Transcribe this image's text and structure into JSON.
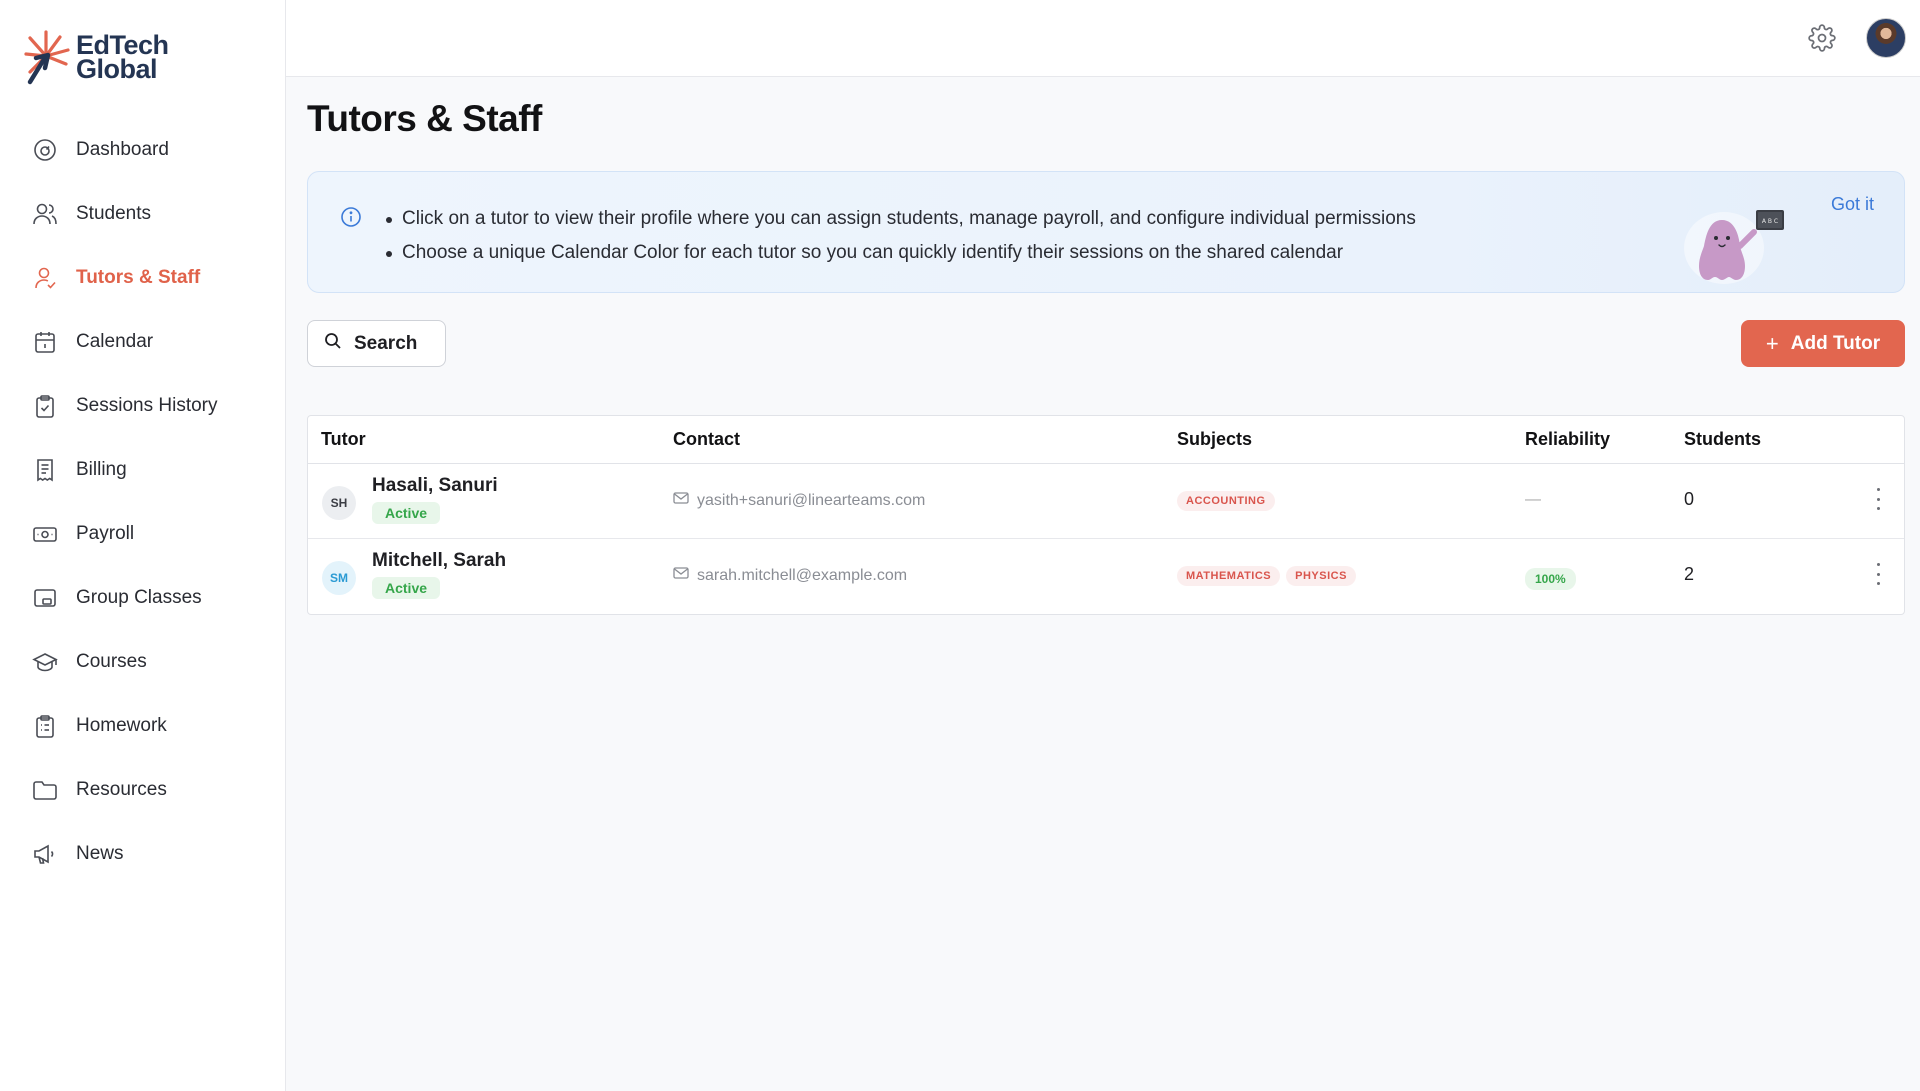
{
  "app": {
    "logo_line1": "EdTech",
    "logo_line2": "Global",
    "brand_color": "#e2664f",
    "brand_dark": "#243553"
  },
  "sidebar": {
    "items": [
      {
        "label": "Dashboard",
        "icon": "dashboard-gauge-icon",
        "active": false
      },
      {
        "label": "Students",
        "icon": "users-icon",
        "active": false
      },
      {
        "label": "Tutors & Staff",
        "icon": "user-check-icon",
        "active": true
      },
      {
        "label": "Calendar",
        "icon": "calendar-icon",
        "active": false
      },
      {
        "label": "Sessions History",
        "icon": "clipboard-check-icon",
        "active": false
      },
      {
        "label": "Billing",
        "icon": "receipt-icon",
        "active": false
      },
      {
        "label": "Payroll",
        "icon": "banknote-icon",
        "active": false
      },
      {
        "label": "Group Classes",
        "icon": "presentation-icon",
        "active": false
      },
      {
        "label": "Courses",
        "icon": "graduation-cap-icon",
        "active": false
      },
      {
        "label": "Homework",
        "icon": "clipboard-list-icon",
        "active": false
      },
      {
        "label": "Resources",
        "icon": "folder-icon",
        "active": false
      },
      {
        "label": "News",
        "icon": "megaphone-icon",
        "active": false
      }
    ]
  },
  "topbar": {
    "settings_icon": "gear-icon",
    "avatar_icon": "user-avatar"
  },
  "main": {
    "title": "Tutors & Staff",
    "info": {
      "bullets": [
        "Click on a tutor to view their profile where you can assign students, manage payroll, and configure individual permissions",
        "Choose a unique Calendar Color for each tutor so you can quickly identify their sessions on the shared calendar"
      ],
      "dismiss_label": "Got it",
      "chalkboard_text": "A B C"
    },
    "search_label": "Search",
    "add_label": "Add Tutor"
  },
  "table": {
    "headers": [
      "Tutor",
      "Contact",
      "Subjects",
      "Reliability",
      "Students"
    ],
    "rows": [
      {
        "initials": "SH",
        "initials_bg": "#eceef1",
        "initials_color": "#3b3d44",
        "name": "Hasali, Sanuri",
        "status": "Active",
        "email": "yasith+sanuri@linearteams.com",
        "subjects": [
          "ACCOUNTING"
        ],
        "reliability": "—",
        "students": "0"
      },
      {
        "initials": "SM",
        "initials_bg": "#e3f3fb",
        "initials_color": "#2a9ad3",
        "name": "Mitchell, Sarah",
        "status": "Active",
        "email": "sarah.mitchell@example.com",
        "subjects": [
          "MATHEMATICS",
          "PHYSICS"
        ],
        "reliability": "100%",
        "students": "2"
      }
    ]
  }
}
